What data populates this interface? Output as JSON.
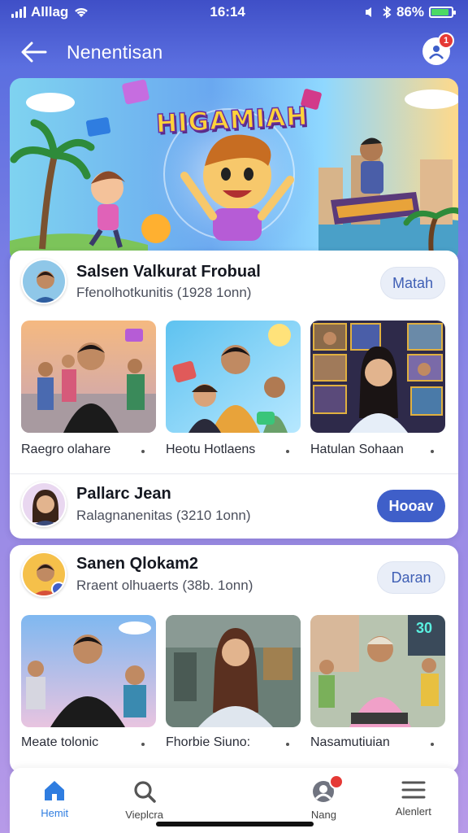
{
  "status_bar": {
    "carrier": "Alllag",
    "time": "16:14",
    "battery": "86%",
    "battery_level": 0.86
  },
  "header": {
    "title": "Nenentisan",
    "back_icon": "arrow-left-icon",
    "notif_icon": "profile-icon",
    "notif_badge": "1"
  },
  "hero": {
    "title": "HIGAMIAH"
  },
  "feed": [
    {
      "creator": {
        "name": "Salsen Valkurat Frobual",
        "meta": "Ffenolhotkunitis (1928 1onn)",
        "button": "Matah"
      },
      "videos": [
        {
          "caption": "Raegro olahare"
        },
        {
          "caption": "Heotu Hotlaens"
        },
        {
          "caption": "Hatulan Sohaan"
        }
      ],
      "footer": {
        "name": "Pallarc Jean",
        "meta": "Ralagnanenitas (3210 1onn)",
        "button": "Hooav"
      }
    },
    {
      "creator": {
        "name": "Sanen Qlokam2",
        "meta": "Rraent olhuaerts (38b. 1onn)",
        "button": "Daran"
      },
      "videos": [
        {
          "caption": "Meate tolonic"
        },
        {
          "caption": "Fhorbie Siuno:"
        },
        {
          "caption": "Nasamutiuian"
        }
      ]
    }
  ],
  "bottom_nav": [
    {
      "label": "Hemit",
      "icon": "home-icon",
      "active": true
    },
    {
      "label": "Vieplcra",
      "icon": "search-icon",
      "active": false
    },
    {
      "label": "",
      "icon": "",
      "active": false
    },
    {
      "label": "Nang",
      "icon": "profile-icon",
      "active": false
    },
    {
      "label": "Alenlert",
      "icon": "menu-icon",
      "active": false
    }
  ],
  "colors": {
    "accent": "#3f5fc9",
    "badge": "#e53935",
    "nav_active": "#2f7de0"
  }
}
